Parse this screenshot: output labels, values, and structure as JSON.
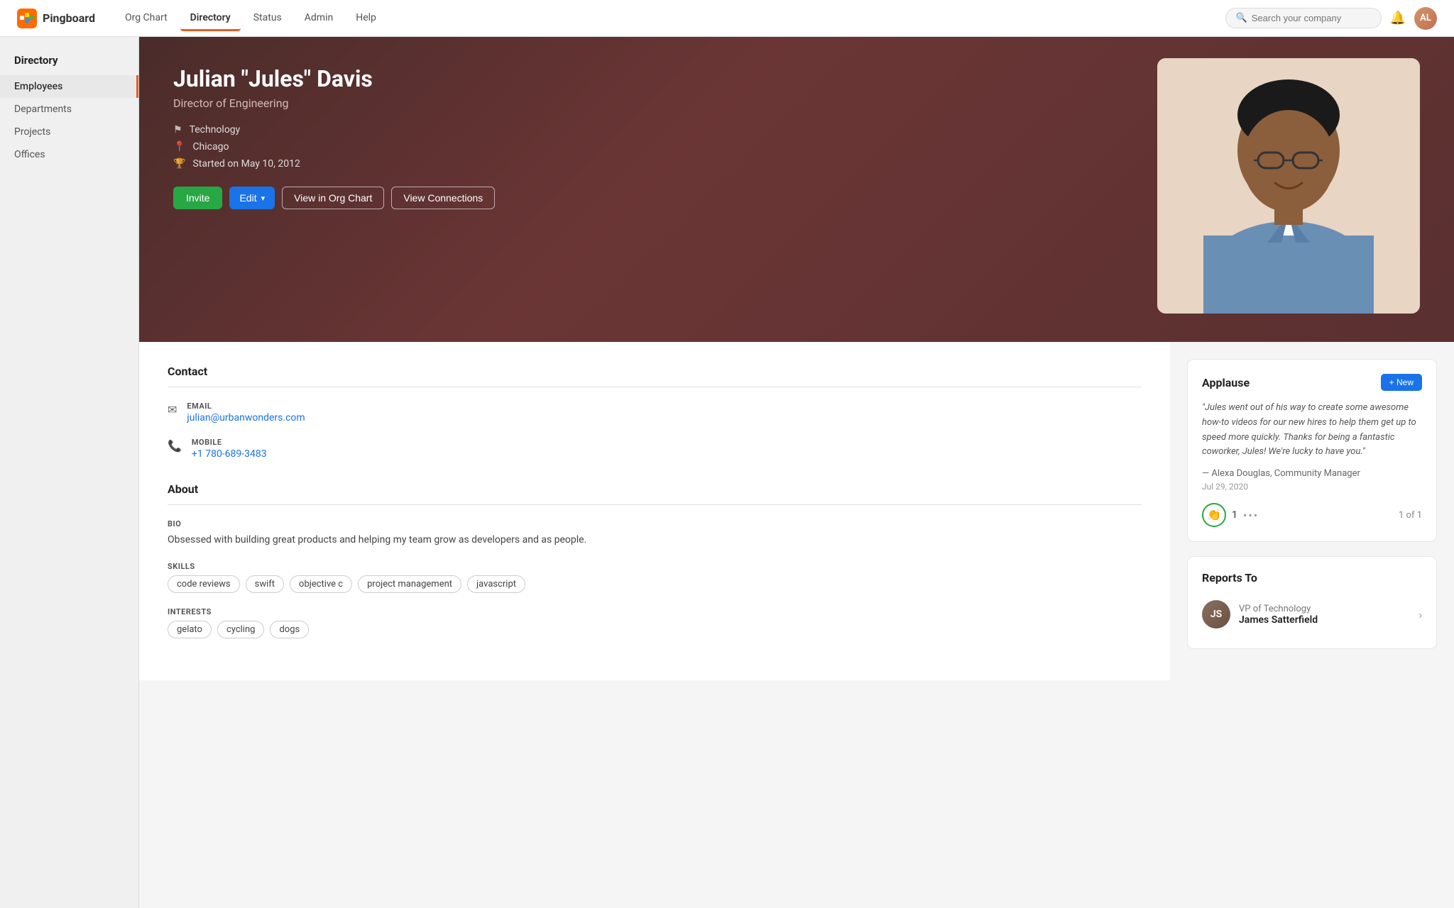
{
  "app": {
    "logo_text": "Pingboard",
    "nav_links": [
      {
        "label": "Org Chart",
        "id": "org-chart",
        "active": false
      },
      {
        "label": "Directory",
        "id": "directory",
        "active": true
      },
      {
        "label": "Status",
        "id": "status",
        "active": false
      },
      {
        "label": "Admin",
        "id": "admin",
        "active": false
      },
      {
        "label": "Help",
        "id": "help",
        "active": false
      }
    ],
    "search_placeholder": "Search your company",
    "user_initials": "AL"
  },
  "sidebar": {
    "title": "Directory",
    "items": [
      {
        "label": "Employees",
        "active": true
      },
      {
        "label": "Departments",
        "active": false
      },
      {
        "label": "Projects",
        "active": false
      },
      {
        "label": "Offices",
        "active": false
      }
    ]
  },
  "profile": {
    "name": "Julian \"Jules\" Davis",
    "title": "Director of Engineering",
    "department": "Technology",
    "location": "Chicago",
    "started": "Started on May 10, 2012",
    "buttons": {
      "invite": "Invite",
      "edit": "Edit",
      "view_org_chart": "View in Org Chart",
      "view_connections": "View Connections"
    },
    "contact": {
      "email_label": "EMAIL",
      "email": "julian@urbanwonders.com",
      "mobile_label": "MOBILE",
      "mobile": "+1 780-689-3483"
    },
    "about": {
      "section_title": "About",
      "contact_title": "Contact",
      "bio_label": "BIO",
      "bio_text": "Obsessed with building great products and helping my team grow as developers and as people.",
      "skills_label": "SKILLS",
      "skills": [
        "code reviews",
        "swift",
        "objective c",
        "project management",
        "javascript"
      ],
      "interests_label": "INTERESTS",
      "interests": [
        "gelato",
        "cycling",
        "dogs"
      ]
    }
  },
  "applause": {
    "title": "Applause",
    "new_button": "+ New",
    "quote": "\"Jules went out of his way to create some awesome how-to videos for our new hires to help them get up to speed more quickly. Thanks for being a fantastic coworker, Jules! We're lucky to have you.\"",
    "attribution": "— Alexa Douglas, Community Manager",
    "date": "Jul 29, 2020",
    "reaction_emoji": "👏",
    "reaction_count": "1",
    "more_icon": "•••",
    "pagination": "1 of 1"
  },
  "reports_to": {
    "title": "Reports To",
    "person": {
      "role": "VP of Technology",
      "name": "James Satterfield"
    }
  }
}
